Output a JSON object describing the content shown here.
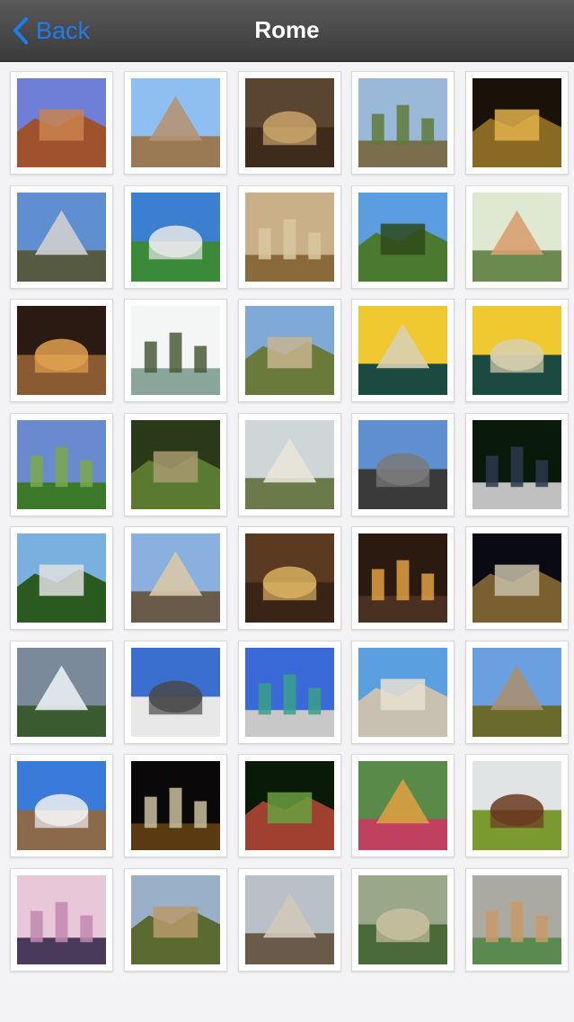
{
  "nav": {
    "back_label": "Back",
    "title": "Rome",
    "accent": "#1e7cf2"
  },
  "photos": [
    {
      "subject": "colosseum",
      "sky": "#6f7fd8",
      "ground": "#a0522d",
      "accent": "#c9844e"
    },
    {
      "subject": "church-dome",
      "sky": "#8fbff0",
      "ground": "#9a7a55",
      "accent": "#b49573"
    },
    {
      "subject": "church-interior",
      "sky": "#5a4530",
      "ground": "#3d2c1c",
      "accent": "#c8a26a"
    },
    {
      "subject": "forum-ruins",
      "sky": "#9ab8d8",
      "ground": "#7b6e4d",
      "accent": "#5f7a3a"
    },
    {
      "subject": "colosseum-night",
      "sky": "#1a1208",
      "ground": "#8a6a22",
      "accent": "#e0b04a"
    },
    {
      "subject": "pyramid",
      "sky": "#5f8fd0",
      "ground": "#555a40",
      "accent": "#cfcfcf"
    },
    {
      "subject": "vittoriano",
      "sky": "#3a7fd0",
      "ground": "#3a8a3a",
      "accent": "#e8e8e8"
    },
    {
      "subject": "fresco-ceiling",
      "sky": "#c9b088",
      "ground": "#8a6a3a",
      "accent": "#d8c8a0"
    },
    {
      "subject": "pine-tree",
      "sky": "#5a9de0",
      "ground": "#4a7a30",
      "accent": "#2e4a1a"
    },
    {
      "subject": "villa-garden",
      "sky": "#dfe8d0",
      "ground": "#6a8a50",
      "accent": "#d8a070"
    },
    {
      "subject": "archway-street",
      "sky": "#2a1a12",
      "ground": "#8a5a30",
      "accent": "#e0a050"
    },
    {
      "subject": "river-view",
      "sky": "#f4f6f6",
      "ground": "#8aa69a",
      "accent": "#4a5a3a"
    },
    {
      "subject": "column-ruins",
      "sky": "#7faad8",
      "ground": "#6a7a3a",
      "accent": "#c8b490"
    },
    {
      "subject": "bridge",
      "sky": "#f0c830",
      "ground": "#1a4a40",
      "accent": "#d8d0b0"
    },
    {
      "subject": "bridge",
      "sky": "#f0c830",
      "ground": "#1a4a40",
      "accent": "#d8d0b0"
    },
    {
      "subject": "park-field",
      "sky": "#6a8ad0",
      "ground": "#3a7a2a",
      "accent": "#7aa84a"
    },
    {
      "subject": "fountain-garden",
      "sky": "#2a3a18",
      "ground": "#5a7a30",
      "accent": "#a89a70"
    },
    {
      "subject": "st-peters-distant",
      "sky": "#cfd6d8",
      "ground": "#6a7a4a",
      "accent": "#e8e4d8"
    },
    {
      "subject": "statue-sky",
      "sky": "#5f8fd0",
      "ground": "#3a3a3a",
      "accent": "#7a7a7a"
    },
    {
      "subject": "bronze-statue",
      "sky": "#0a1a0a",
      "ground": "#c0c0c0",
      "accent": "#2a3a4a"
    },
    {
      "subject": "cemetery-trees",
      "sky": "#7ab0e0",
      "ground": "#2a5a20",
      "accent": "#e0e0e0"
    },
    {
      "subject": "trajan-column",
      "sky": "#8ab0e0",
      "ground": "#6a5a4a",
      "accent": "#d8c8a8"
    },
    {
      "subject": "altar-gold",
      "sky": "#5a3a20",
      "ground": "#3a2416",
      "accent": "#d8b060"
    },
    {
      "subject": "basilica-interior",
      "sky": "#2a1a10",
      "ground": "#4a3020",
      "accent": "#e0a040"
    },
    {
      "subject": "arch-night",
      "sky": "#0a0a14",
      "ground": "#7a6030",
      "accent": "#c8c0a8"
    },
    {
      "subject": "cloudy-sky",
      "sky": "#7a8a9a",
      "ground": "#3a5a30",
      "accent": "#e8eef4"
    },
    {
      "subject": "equestrian-statue",
      "sky": "#3a6fd0",
      "ground": "#e8e8e8",
      "accent": "#4a4a4a"
    },
    {
      "subject": "green-dome",
      "sky": "#3a6ad8",
      "ground": "#c8c8c8",
      "accent": "#3aa088"
    },
    {
      "subject": "st-peters",
      "sky": "#5aa0e0",
      "ground": "#c8c0b0",
      "accent": "#e8e0d0"
    },
    {
      "subject": "triumphal-arch",
      "sky": "#6aa0e0",
      "ground": "#6a6a2a",
      "accent": "#a89070"
    },
    {
      "subject": "temple-tree",
      "sky": "#3a7ad8",
      "ground": "#8a6a4a",
      "accent": "#f0f0f0"
    },
    {
      "subject": "pyramid-night",
      "sky": "#0a0808",
      "ground": "#5a3a10",
      "accent": "#c8c0a0"
    },
    {
      "subject": "garden-path",
      "sky": "#0a1a08",
      "ground": "#a04030",
      "accent": "#6aa040"
    },
    {
      "subject": "flower-garden",
      "sky": "#5a8a4a",
      "ground": "#c04060",
      "accent": "#d8a040"
    },
    {
      "subject": "circus-maximus",
      "sky": "#e0e4e4",
      "ground": "#7a9a30",
      "accent": "#6a3a20"
    },
    {
      "subject": "st-peters-dusk",
      "sky": "#e8c8d8",
      "ground": "#4a3a5a",
      "accent": "#c08ab0"
    },
    {
      "subject": "city-panorama",
      "sky": "#9ab0c8",
      "ground": "#5a6a30",
      "accent": "#b89a6a"
    },
    {
      "subject": "rooftops",
      "sky": "#b8c0c8",
      "ground": "#6a5a4a",
      "accent": "#d0c8b8"
    },
    {
      "subject": "aqueduct",
      "sky": "#9aa88a",
      "ground": "#4a6a3a",
      "accent": "#c8c0a0"
    },
    {
      "subject": "garden-fountain",
      "sky": "#aaaaa0",
      "ground": "#5a8a50",
      "accent": "#c89a6a"
    }
  ]
}
